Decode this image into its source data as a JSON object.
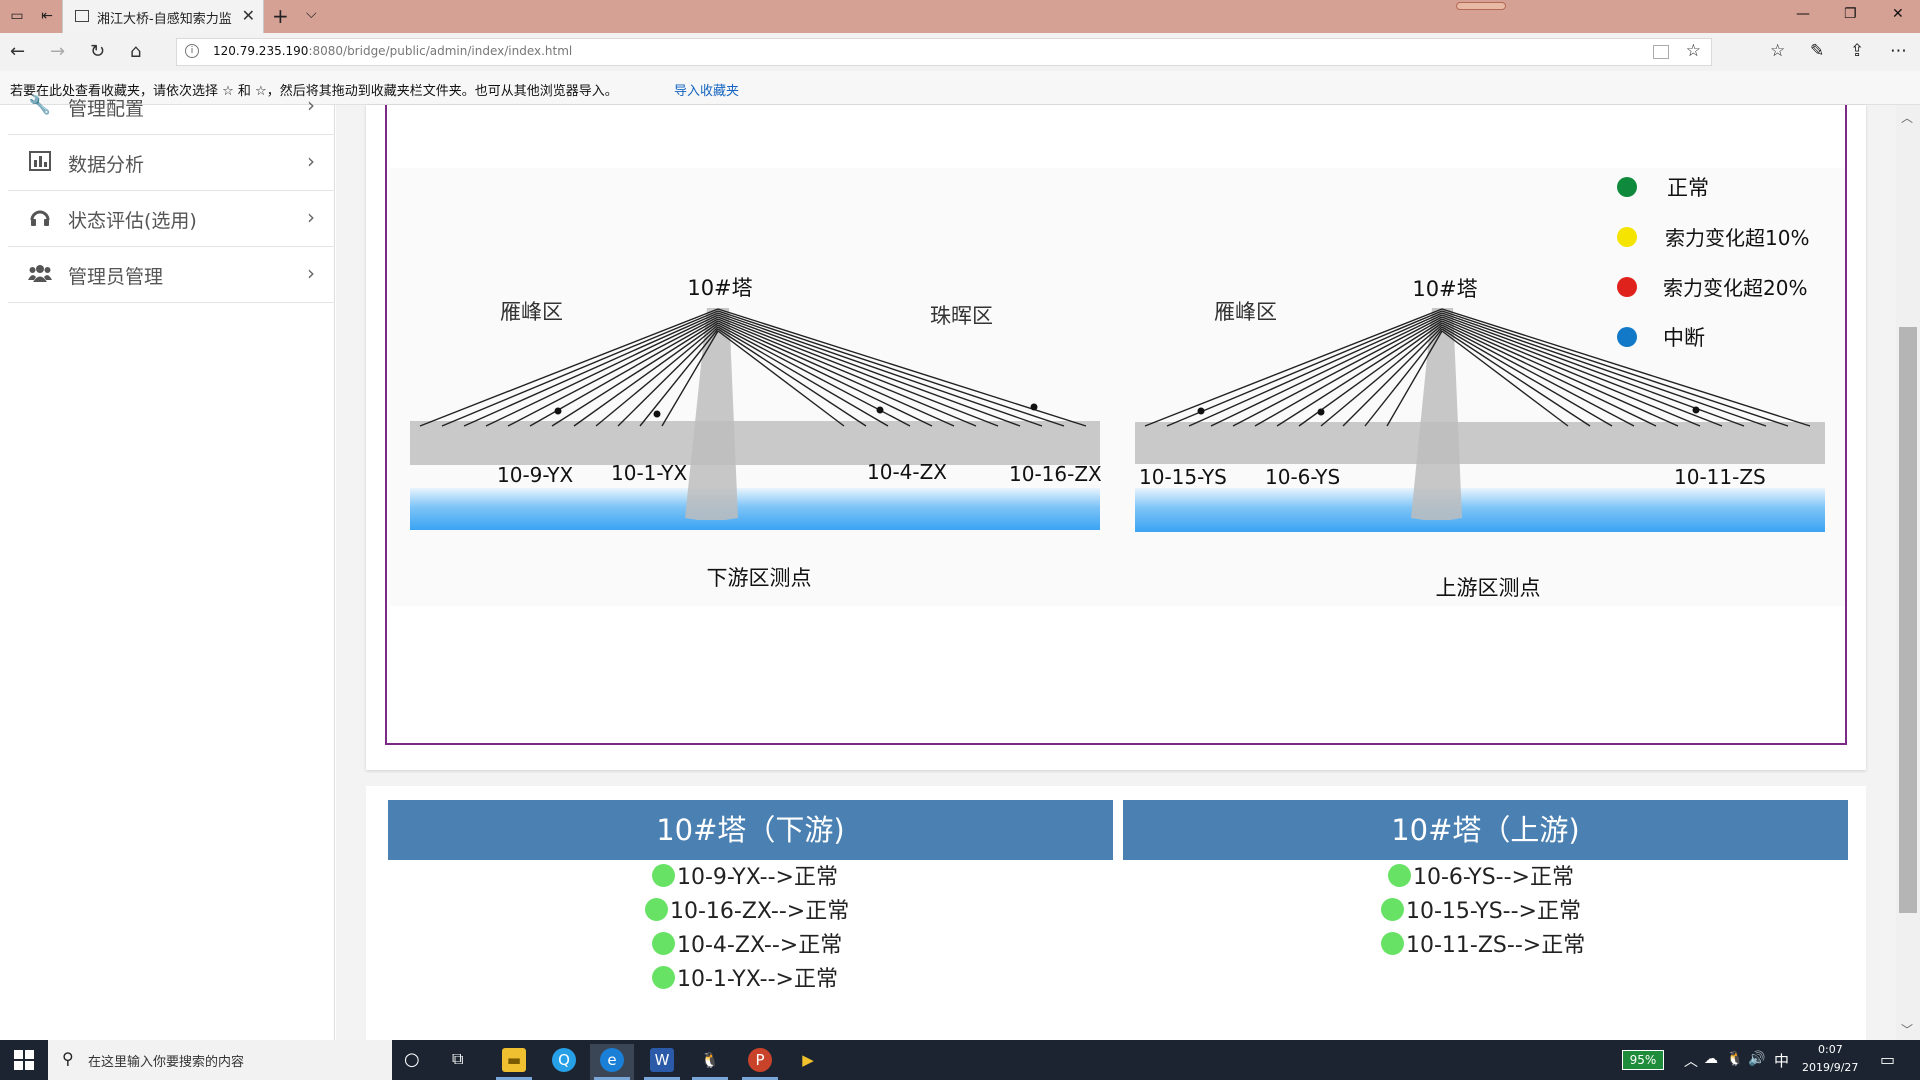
{
  "browser": {
    "tab_title": "湘江大桥-自感知索力监",
    "url_host": "120.79.235.190",
    "url_path": ":8080/bridge/public/admin/index/index.html",
    "favbar_message": "若要在此处查看收藏夹，请依次选择 ☆ 和 ☆，然后将其拖动到收藏夹栏文件夹。也可从其他浏览器导入。",
    "favbar_link": "导入收藏夹"
  },
  "sidebar": {
    "items": [
      {
        "label": "管理配置",
        "icon": "wrench-icon"
      },
      {
        "label": "数据分析",
        "icon": "bar-chart-icon"
      },
      {
        "label": "状态评估(选用)",
        "icon": "headphones-icon"
      },
      {
        "label": "管理员管理",
        "icon": "users-icon"
      }
    ]
  },
  "diagram": {
    "left": {
      "tower": "10#塔",
      "zone_left": "雁峰区",
      "zone_right": "珠晖区",
      "sensors": [
        "10-9-YX",
        "10-1-YX",
        "10-4-ZX",
        "10-16-ZX"
      ],
      "caption": "下游区测点"
    },
    "right": {
      "tower": "10#塔",
      "zone_left": "雁峰区",
      "sensors": [
        "10-15-YS",
        "10-6-YS",
        "10-11-ZS"
      ],
      "caption": "上游区测点"
    },
    "legend": [
      {
        "label": "正常",
        "color": "#0f8a3c"
      },
      {
        "label": "索力变化超10%",
        "color": "#f5e400"
      },
      {
        "label": "索力变化超20%",
        "color": "#e0221d"
      },
      {
        "label": "中断",
        "color": "#1279c8"
      }
    ]
  },
  "status": {
    "downstream": {
      "title": "10#塔（下游)",
      "rows": [
        "10-9-YX-->正常",
        "10-16-ZX-->正常",
        "10-4-ZX-->正常",
        "10-1-YX-->正常"
      ]
    },
    "upstream": {
      "title": "10#塔（上游)",
      "rows": [
        "10-6-YS-->正常",
        "10-15-YS-->正常",
        "10-11-ZS-->正常"
      ]
    },
    "dot_color": "#67e265"
  },
  "taskbar": {
    "search_placeholder": "在这里输入你要搜索的内容",
    "battery": "95%",
    "ime": "中",
    "time": "0:07",
    "date": "2019/9/27"
  }
}
